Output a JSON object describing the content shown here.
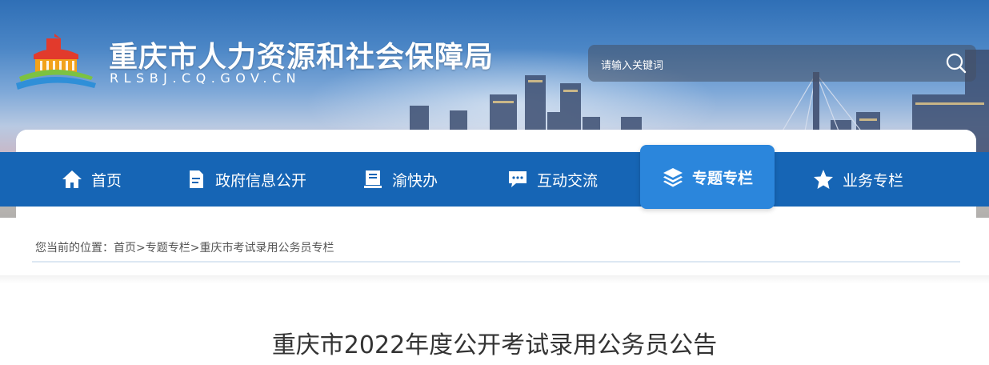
{
  "header": {
    "site_title": "重庆市人力资源和社会保障局",
    "site_domain": "RLSBJ.CQ.GOV.CN",
    "logo": "government-building-logo"
  },
  "search": {
    "placeholder": "请输入关键词",
    "icon": "search-icon"
  },
  "nav": {
    "items": [
      {
        "label": "首页",
        "icon": "home-icon",
        "active": false
      },
      {
        "label": "政府信息公开",
        "icon": "document-icon",
        "active": false
      },
      {
        "label": "渝快办",
        "icon": "book-icon",
        "active": false
      },
      {
        "label": "互动交流",
        "icon": "chat-icon",
        "active": false
      },
      {
        "label": "专题专栏",
        "icon": "layers-icon",
        "active": true
      },
      {
        "label": "业务专栏",
        "icon": "star-icon",
        "active": false
      }
    ]
  },
  "breadcrumb": {
    "prefix": "您当前的位置：",
    "items": [
      "首页",
      "专题专栏",
      "重庆市考试录用公务员专栏"
    ],
    "separator": ">"
  },
  "article": {
    "title": "重庆市2022年度公开考试录用公务员公告"
  },
  "colors": {
    "nav_bg": "#1665b5",
    "nav_active_bg": "#2b86dc",
    "title_text": "#333333"
  }
}
